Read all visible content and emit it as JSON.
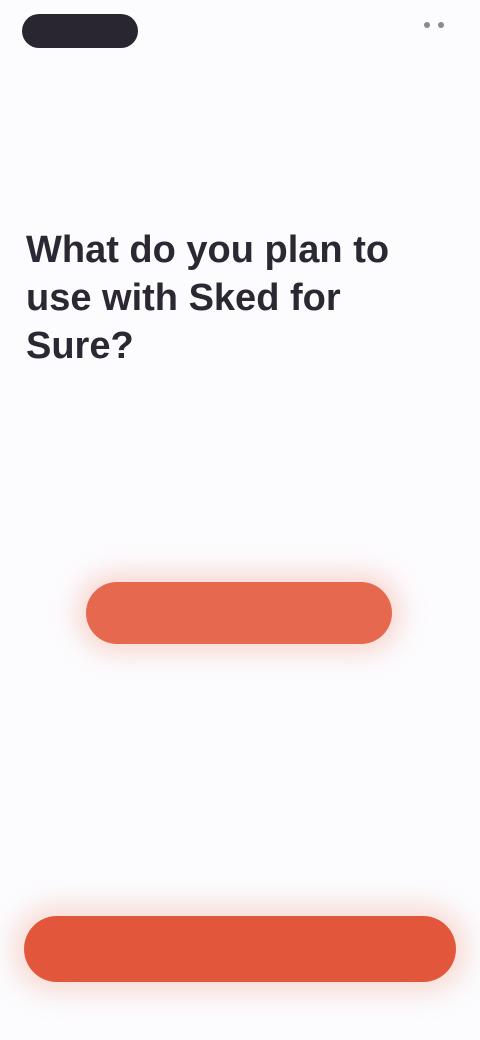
{
  "status_bar": {
    "time": "",
    "indicators": ""
  },
  "question": {
    "title": "What do you plan to use with Sked for Sure?"
  },
  "options": [
    {
      "label": ""
    },
    {
      "label": ""
    },
    {
      "label": ""
    },
    {
      "label": "",
      "selected": true
    },
    {
      "label": ""
    }
  ],
  "footer": {
    "cta_label": ""
  },
  "colors": {
    "background": "#fcfbfd",
    "accent": "#e2573c",
    "selected_option": "#e6684e",
    "text_dark": "#2c2833"
  }
}
